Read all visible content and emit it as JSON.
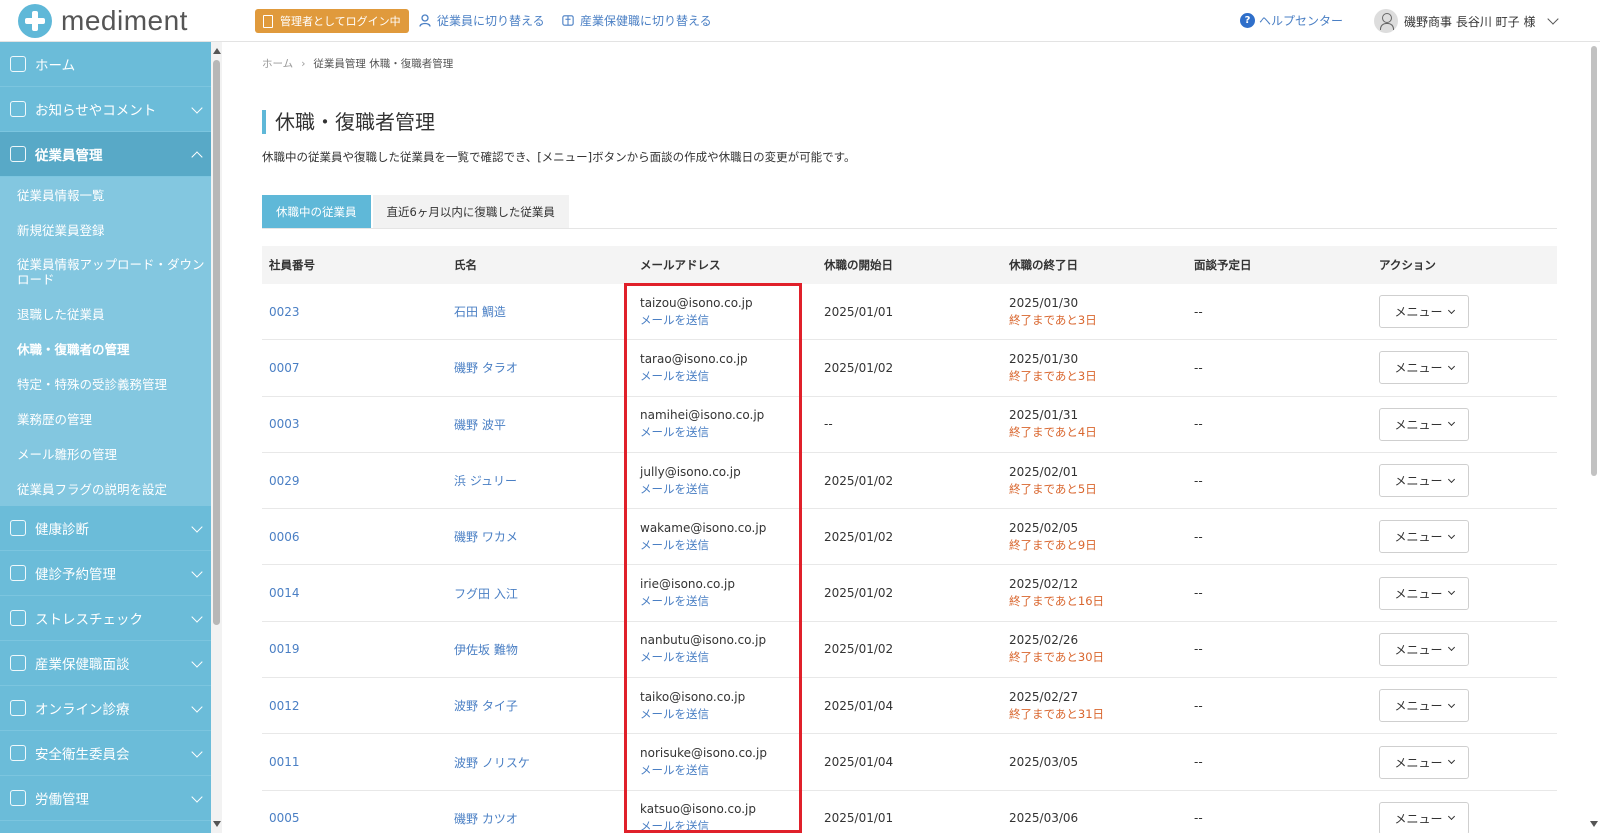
{
  "app": {
    "logo_text": "mediment",
    "admin_badge": "管理者としてログイン中",
    "switch_employee": "従業員に切り替える",
    "switch_occupational_health": "産業保健職に切り替える",
    "help_center": "ヘルプセンター",
    "help_icon": "?",
    "user_name": "磯野商事 長谷川 町子 様"
  },
  "sidebar": {
    "items": [
      {
        "label": "ホーム",
        "icon": "home-icon"
      },
      {
        "label": "お知らせやコメント",
        "icon": "bell-icon"
      },
      {
        "label": "従業員管理",
        "icon": "users-icon"
      },
      {
        "label": "健康診断",
        "icon": "stethoscope-icon"
      },
      {
        "label": "健診予約管理",
        "icon": "stethoscope-icon"
      },
      {
        "label": "ストレスチェック",
        "icon": "heart-icon"
      },
      {
        "label": "産業保健職面談",
        "icon": "meeting-icon"
      },
      {
        "label": "オンライン診療",
        "icon": "monitor-icon"
      },
      {
        "label": "安全衛生委員会",
        "icon": "document-icon"
      },
      {
        "label": "労働管理",
        "icon": "calendar-icon"
      }
    ],
    "sub_items": [
      "従業員情報一覧",
      "新規従業員登録",
      "従業員情報アップロード・ダウンロード",
      "退職した従業員",
      "休職・復職者の管理",
      "特定・特殊の受診義務管理",
      "業務歴の管理",
      "メール雛形の管理",
      "従業員フラグの説明を設定"
    ]
  },
  "breadcrumb": {
    "home": "ホーム",
    "sep": "›",
    "current": "従業員管理 休職・復職者管理"
  },
  "page": {
    "title": "休職・復職者管理",
    "description": "休職中の従業員や復職した従業員を一覧で確認でき、[メニュー]ボタンから面談の作成や休職日の変更が可能です。"
  },
  "tabs": [
    "休職中の従業員",
    "直近6ヶ月以内に復職した従業員"
  ],
  "table": {
    "headers": [
      "社員番号",
      "氏名",
      "メールアドレス",
      "休職の開始日",
      "休職の終了日",
      "面談予定日",
      "アクション"
    ],
    "send_mail_label": "メールを送信",
    "menu_label": "メニュー",
    "rows": [
      {
        "id": "0023",
        "name": "石田 鯛造",
        "email": "taizou@isono.co.jp",
        "start": "2025/01/01",
        "end": "2025/01/30",
        "remain": "終了まであと3日",
        "interview": "--"
      },
      {
        "id": "0007",
        "name": "磯野 タラオ",
        "email": "tarao@isono.co.jp",
        "start": "2025/01/02",
        "end": "2025/01/30",
        "remain": "終了まであと3日",
        "interview": "--"
      },
      {
        "id": "0003",
        "name": "磯野 波平",
        "email": "namihei@isono.co.jp",
        "start": "--",
        "end": "2025/01/31",
        "remain": "終了まであと4日",
        "interview": "--"
      },
      {
        "id": "0029",
        "name": "浜 ジュリー",
        "email": "jully@isono.co.jp",
        "start": "2025/01/02",
        "end": "2025/02/01",
        "remain": "終了まであと5日",
        "interview": "--"
      },
      {
        "id": "0006",
        "name": "磯野 ワカメ",
        "email": "wakame@isono.co.jp",
        "start": "2025/01/02",
        "end": "2025/02/05",
        "remain": "終了まであと9日",
        "interview": "--"
      },
      {
        "id": "0014",
        "name": "フグ田 入江",
        "email": "irie@isono.co.jp",
        "start": "2025/01/02",
        "end": "2025/02/12",
        "remain": "終了まであと16日",
        "interview": "--"
      },
      {
        "id": "0019",
        "name": "伊佐坂 難物",
        "email": "nanbutu@isono.co.jp",
        "start": "2025/01/02",
        "end": "2025/02/26",
        "remain": "終了まであと30日",
        "interview": "--"
      },
      {
        "id": "0012",
        "name": "波野 タイ子",
        "email": "taiko@isono.co.jp",
        "start": "2025/01/04",
        "end": "2025/02/27",
        "remain": "終了まであと31日",
        "interview": "--"
      },
      {
        "id": "0011",
        "name": "波野 ノリスケ",
        "email": "norisuke@isono.co.jp",
        "start": "2025/01/04",
        "end": "2025/03/05",
        "remain": "",
        "interview": "--"
      },
      {
        "id": "0005",
        "name": "磯野 カツオ",
        "email": "katsuo@isono.co.jp",
        "start": "2025/01/01",
        "end": "2025/03/06",
        "remain": "",
        "interview": "--"
      }
    ]
  },
  "colors": {
    "sidebar": "#6bbcd9",
    "accent": "#5fb8d8",
    "link": "#4a7fc4",
    "warning": "#d9662e",
    "admin_badge": "#e09a3c",
    "highlight": "#e0202a"
  }
}
